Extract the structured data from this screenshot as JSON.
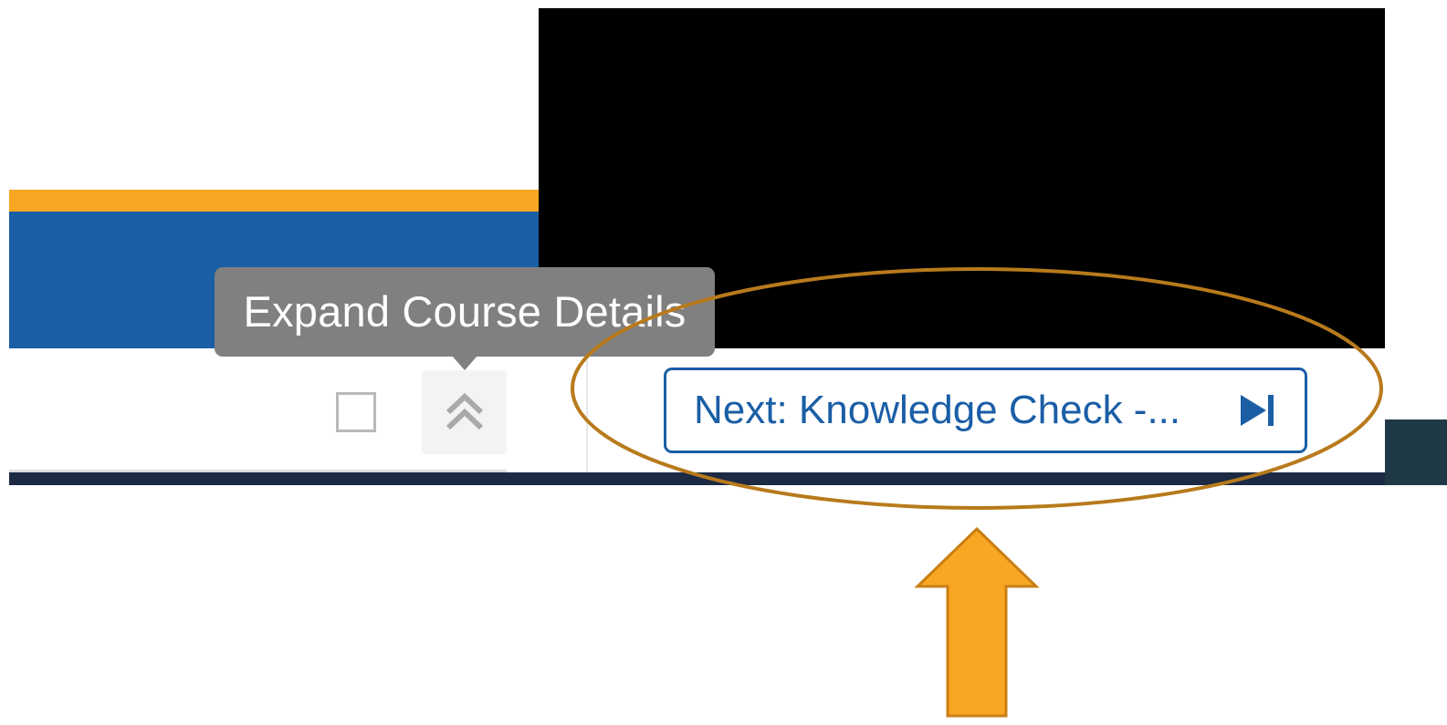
{
  "tooltip": {
    "text": "Expand Course Details"
  },
  "toolbar": {
    "next_button_label": "Next: Knowledge Check -...",
    "next_icon": "skip-next-icon",
    "expand_icon": "double-chevron-up-icon"
  },
  "colors": {
    "brand_blue": "#1a5ea6",
    "accent_orange": "#f8a623",
    "tooltip_gray": "#808080",
    "footer_navy": "#1c2a44",
    "annotation_ellipse": "#b87a1c",
    "annotation_arrow": "#f8a623"
  }
}
